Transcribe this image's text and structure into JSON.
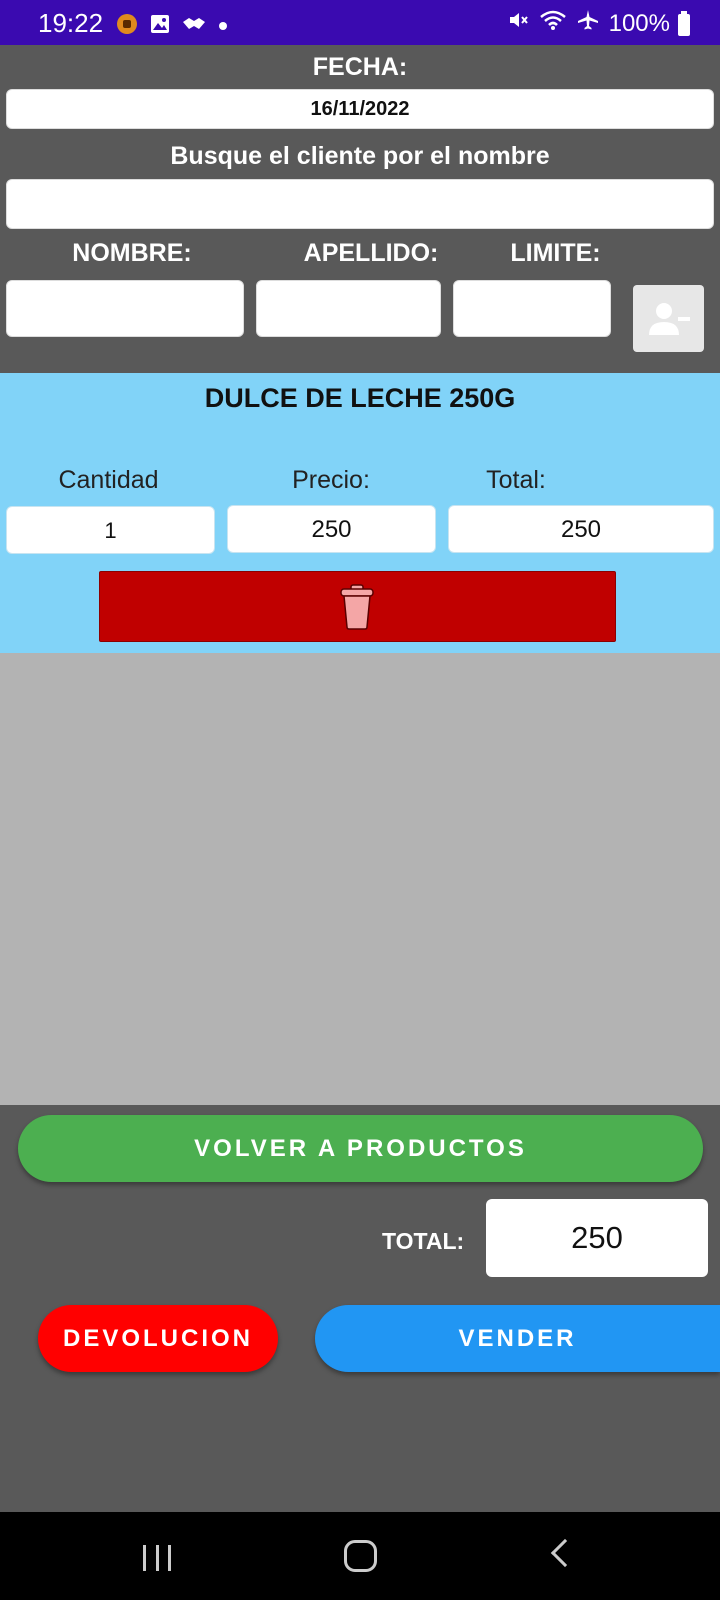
{
  "status_bar": {
    "time": "19:22",
    "battery": "100%",
    "icons_left": [
      "notification-app-icon",
      "gallery-icon",
      "handshake-icon",
      "dot-icon"
    ],
    "icons_right": [
      "mute-icon",
      "wifi-icon",
      "airplane-icon",
      "battery-icon"
    ]
  },
  "header": {
    "date_label": "FECHA:",
    "date_value": "16/11/2022",
    "search_label": "Busque el cliente por el nombre",
    "search_value": "",
    "name_label": "NOMBRE:",
    "surname_label": "APELLIDO:",
    "limit_label": "LIMITE:",
    "name_value": "",
    "surname_value": "",
    "limit_value": ""
  },
  "item": {
    "title": "DULCE DE LECHE 250G",
    "quantity_label": "Cantidad",
    "price_label": "Precio:",
    "total_label": "Total:",
    "quantity": "1",
    "price": "250",
    "total": "250"
  },
  "bottom": {
    "back_button": "VOLVER A PRODUCTOS",
    "total_label": "TOTAL:",
    "total_value": "250",
    "return_button": "DEVOLUCION",
    "sell_button": "VENDER"
  },
  "colors": {
    "status_bar": "#3a0ab0",
    "background": "#595959",
    "item_card": "#81d3f8",
    "delete": "#c00000",
    "back_button": "#4caf50",
    "return_button": "#ff0000",
    "sell_button": "#2196f3",
    "list_area": "#b3b3b3"
  }
}
